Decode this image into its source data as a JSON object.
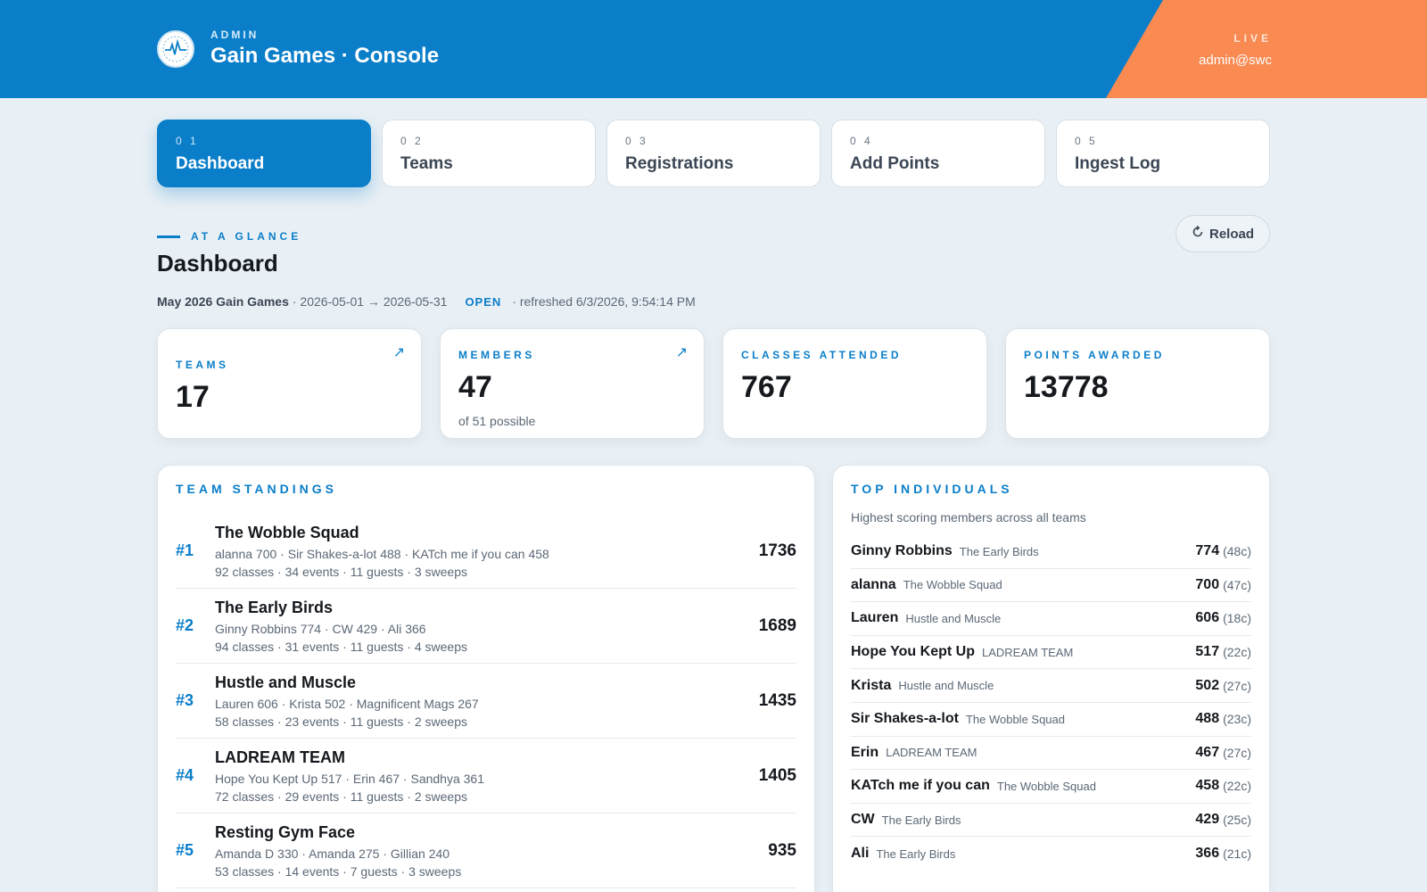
{
  "header": {
    "kicker": "ADMIN",
    "title": "Gain Games · Console",
    "live_label": "LIVE",
    "user": "admin@swc",
    "logo_icon": "heartbeat-logo-icon"
  },
  "tabs": [
    {
      "num": "0 1",
      "label": "Dashboard",
      "active": true
    },
    {
      "num": "0 2",
      "label": "Teams"
    },
    {
      "num": "0 3",
      "label": "Registrations"
    },
    {
      "num": "0 4",
      "label": "Add Points"
    },
    {
      "num": "0 5",
      "label": "Ingest Log"
    }
  ],
  "section": {
    "kicker": "AT A GLANCE",
    "title": "Dashboard",
    "reload_label": "Reload",
    "reload_icon": "refresh-icon"
  },
  "meta": {
    "event": "May 2026 Gain Games",
    "range": "· 2026-05-01 → 2026-05-31",
    "status": "OPEN",
    "refreshed": "· refreshed 6/3/2026, 9:54:14 PM"
  },
  "stats": {
    "teams": {
      "label": "TEAMS",
      "value": "17"
    },
    "members": {
      "label": "MEMBERS",
      "value": "47",
      "sub": "of 51 possible"
    },
    "classes": {
      "label": "CLASSES ATTENDED",
      "value": "767"
    },
    "points": {
      "label": "POINTS AWARDED",
      "value": "13778"
    }
  },
  "standings": {
    "title": "TEAM STANDINGS",
    "rows": [
      {
        "rank": "#1",
        "name": "The Wobble Squad",
        "members": "alanna 700 · Sir Shakes-a-lot 488 · KATch me if you can 458",
        "stats": "92 classes · 34 events · 11 guests · 3 sweeps",
        "points": "1736"
      },
      {
        "rank": "#2",
        "name": "The Early Birds",
        "members": "Ginny Robbins 774 · CW 429 · Ali 366",
        "stats": "94 classes · 31 events · 11 guests · 4 sweeps",
        "points": "1689"
      },
      {
        "rank": "#3",
        "name": "Hustle and Muscle",
        "members": "Lauren 606 · Krista 502 · Magnificent Mags 267",
        "stats": "58 classes · 23 events · 11 guests · 2 sweeps",
        "points": "1435"
      },
      {
        "rank": "#4",
        "name": "LADREAM TEAM",
        "members": "Hope You Kept Up 517 · Erin 467 · Sandhya 361",
        "stats": "72 classes · 29 events · 11 guests · 2 sweeps",
        "points": "1405"
      },
      {
        "rank": "#5",
        "name": "Resting Gym Face",
        "members": "Amanda D 330 · Amanda 275 · Gillian 240",
        "stats": "53 classes · 14 events · 7 guests · 3 sweeps",
        "points": "935"
      }
    ]
  },
  "individuals": {
    "title": "TOP INDIVIDUALS",
    "subtitle": "Highest scoring members across all teams",
    "rows": [
      {
        "name": "Ginny Robbins",
        "team": "The Early Birds",
        "points": "774",
        "classes": "(48c)"
      },
      {
        "name": "alanna",
        "team": "The Wobble Squad",
        "points": "700",
        "classes": "(47c)"
      },
      {
        "name": "Lauren",
        "team": "Hustle and Muscle",
        "points": "606",
        "classes": "(18c)"
      },
      {
        "name": "Hope You Kept Up",
        "team": "LADREAM TEAM",
        "points": "517",
        "classes": "(22c)"
      },
      {
        "name": "Krista",
        "team": "Hustle and Muscle",
        "points": "502",
        "classes": "(27c)"
      },
      {
        "name": "Sir Shakes-a-lot",
        "team": "The Wobble Squad",
        "points": "488",
        "classes": "(23c)"
      },
      {
        "name": "Erin",
        "team": "LADREAM TEAM",
        "points": "467",
        "classes": "(27c)"
      },
      {
        "name": "KATch me if you can",
        "team": "The Wobble Squad",
        "points": "458",
        "classes": "(22c)"
      },
      {
        "name": "CW",
        "team": "The Early Birds",
        "points": "429",
        "classes": "(25c)"
      },
      {
        "name": "Ali",
        "team": "The Early Birds",
        "points": "366",
        "classes": "(21c)"
      }
    ]
  },
  "colors": {
    "primary": "#0a7ec9",
    "accent": "#f98a52",
    "background": "#e9f0f5"
  }
}
